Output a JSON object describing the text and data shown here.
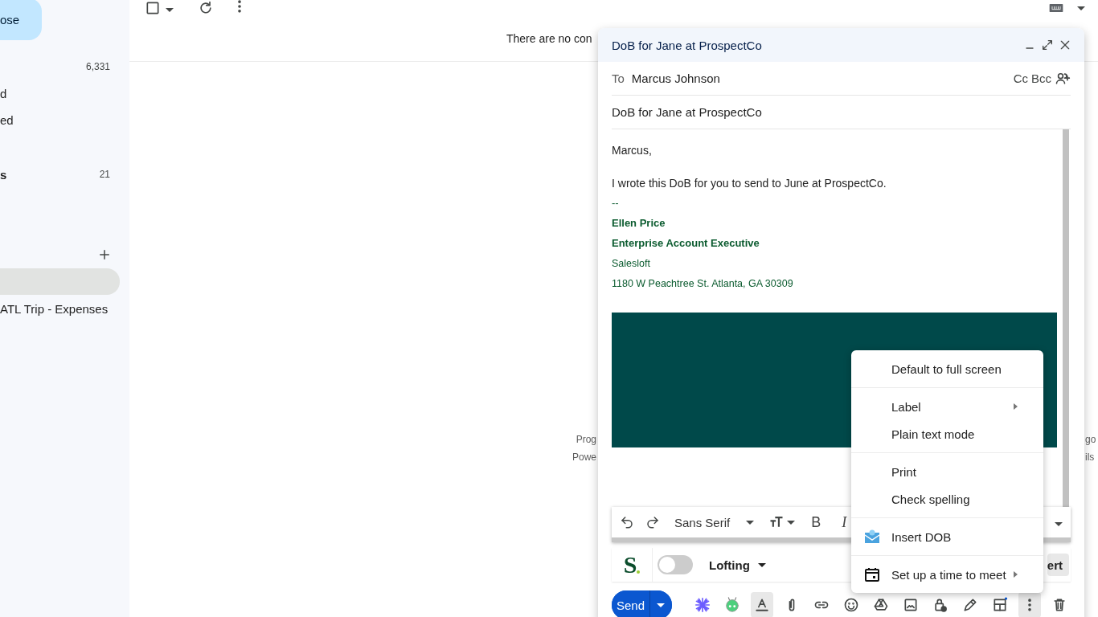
{
  "sidebar": {
    "compose": "ose",
    "nav_items": [
      {
        "count": "6,331"
      },
      {
        "label": "d",
        "bold": false
      },
      {
        "label": "ed",
        "bold": false
      },
      {
        "label": "s",
        "count": "21",
        "bold": true
      }
    ],
    "labels": [
      {
        "selected": true
      },
      {
        "label": "ATL Trip - Expenses",
        "selected": false
      }
    ]
  },
  "main": {
    "empty_message": "There are no con",
    "footer_left": [
      "Prog",
      "Powe"
    ],
    "footer_right": [
      "go",
      "ils"
    ]
  },
  "compose": {
    "title": "DoB for Jane at ProspectCo",
    "to_label": "To",
    "to": "Marcus Johnson",
    "cc": "Cc",
    "bcc": "Bcc",
    "subject": "DoB for Jane at ProspectCo",
    "body": [
      {
        "kind": "text",
        "text": "Marcus,"
      },
      {
        "kind": "gap"
      },
      {
        "kind": "text",
        "text": "I wrote this DoB for you to send to June at ProspectCo."
      },
      {
        "kind": "sig",
        "text": "--"
      },
      {
        "kind": "sig-bold",
        "text": "Ellen Price"
      },
      {
        "kind": "sig-bold",
        "text": "Enterprise Account Executive"
      },
      {
        "kind": "sig-small",
        "text": "Salesloft"
      },
      {
        "kind": "sig-small",
        "text": "1180 W Peachtree St. Atlanta, GA 30309"
      }
    ],
    "format_bar": {
      "font": "Sans Serif",
      "bold": "B",
      "italic": "I"
    },
    "salesloft": {
      "logo": "S",
      "toggle_on": false,
      "cadence": "Lofting",
      "action": "ert"
    },
    "send": "Send",
    "formatting_on": true,
    "menu_open": true
  },
  "menu": [
    [
      {
        "label": "Default to full screen",
        "kind": "plain"
      }
    ],
    [
      {
        "label": "Label",
        "kind": "submenu"
      },
      {
        "label": "Plain text mode",
        "kind": "plain"
      }
    ],
    [
      {
        "label": "Print",
        "kind": "plain"
      },
      {
        "label": "Check spelling",
        "kind": "plain"
      }
    ],
    [
      {
        "label": "Insert DOB",
        "kind": "dob"
      }
    ],
    [
      {
        "label": "Set up a time to meet",
        "kind": "meeting"
      }
    ]
  ]
}
